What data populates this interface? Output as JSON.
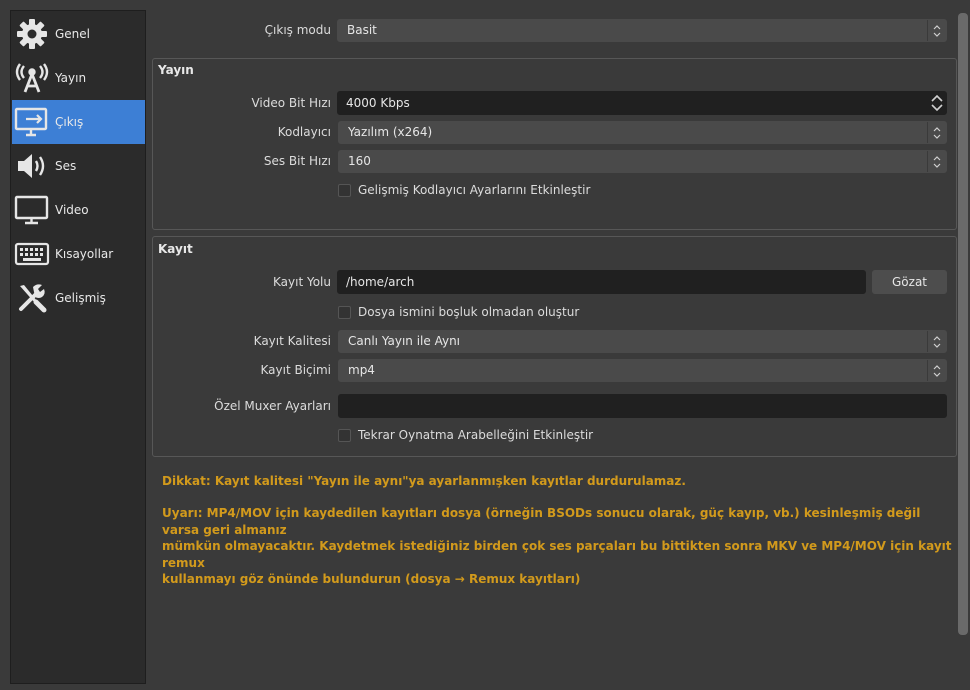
{
  "sidebar": {
    "items": [
      {
        "label": "Genel",
        "icon": "gear-icon"
      },
      {
        "label": "Yayın",
        "icon": "broadcast-antenna-icon"
      },
      {
        "label": "Çıkış",
        "icon": "monitor-output-icon"
      },
      {
        "label": "Ses",
        "icon": "speaker-icon"
      },
      {
        "label": "Video",
        "icon": "monitor-icon"
      },
      {
        "label": "Kısayollar",
        "icon": "keyboard-icon"
      },
      {
        "label": "Gelişmiş",
        "icon": "tools-icon"
      }
    ],
    "selected": "Çıkış",
    "accent": "#3d7fd5"
  },
  "output_mode": {
    "label": "Çıkış modu",
    "value": "Basit"
  },
  "stream": {
    "title": "Yayın",
    "video_bitrate": {
      "label": "Video Bit Hızı",
      "value": "4000 Kbps"
    },
    "encoder": {
      "label": "Kodlayıcı",
      "value": "Yazılım (x264)"
    },
    "audio_bitrate": {
      "label": "Ses Bit Hızı",
      "value": "160"
    },
    "advanced_encoder": {
      "label": "Gelişmiş Kodlayıcı Ayarlarını Etkinleştir",
      "checked": false
    }
  },
  "recording": {
    "title": "Kayıt",
    "path": {
      "label": "Kayıt Yolu",
      "value": "/home/arch",
      "browse": "Gözat"
    },
    "no_space": {
      "label": "Dosya ismini boşluk olmadan oluştur",
      "checked": false
    },
    "quality": {
      "label": "Kayıt Kalitesi",
      "value": "Canlı Yayın ile Aynı"
    },
    "format": {
      "label": "Kayıt Biçimi",
      "value": "mp4"
    },
    "muxer": {
      "label": "Özel Muxer Ayarları",
      "value": ""
    },
    "replay_buffer": {
      "label": "Tekrar Oynatma Arabelleğini Etkinleştir",
      "checked": false
    }
  },
  "warnings": {
    "color": "#d29a1c",
    "notice": "Dikkat: Kayıt kalitesi \"Yayın ile aynı\"ya ayarlanmışken kayıtlar durdurulamaz.",
    "mp4_line1": "Uyarı: MP4/MOV için kaydedilen kayıtları dosya (örneğin BSODs sonucu olarak, güç kayıp, vb.) kesinleşmiş değil varsa geri almanız",
    "mp4_line2": "mümkün olmayacaktır. Kaydetmek istediğiniz birden çok ses parçaları bu bittikten sonra MKV ve MP4/MOV için kayıt remux",
    "mp4_line3": "kullanmayı göz önünde bulundurun (dosya → Remux kayıtları)"
  }
}
